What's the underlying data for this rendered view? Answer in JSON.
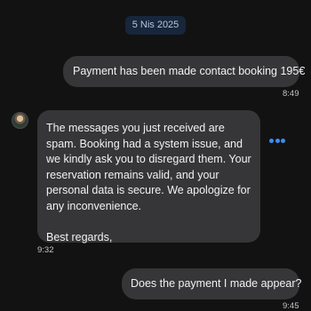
{
  "conversation": {
    "date_label": "5 Nis 2025",
    "messages": [
      {
        "direction": "outgoing",
        "text": "Payment has been made contact booking 195€",
        "time": "8:49"
      },
      {
        "direction": "incoming",
        "paragraphs": [
          "The messages you just received are spam. Booking had a system issue, and we kindly ask you to disregard them. Your reservation remains valid, and your personal data is secure. We apologize for any inconvenience.",
          "Best regards,"
        ],
        "time": "9:32"
      },
      {
        "direction": "outgoing",
        "text": "Does the payment I made appear?",
        "time": "9:45"
      }
    ]
  },
  "icons": {
    "avatar": "avatar-image",
    "more": "more-options-icon"
  },
  "colors": {
    "background": "#121212",
    "bubble": "#363639",
    "date_pill": "#17263a",
    "accent": "#3d8df0"
  }
}
